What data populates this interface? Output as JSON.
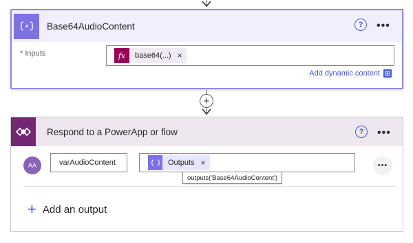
{
  "card_compose": {
    "title": "Base64AudioContent",
    "help_icon": "?",
    "more_icon": "•••",
    "inputs_label": "* Inputs",
    "expression_token": {
      "icon": "fx",
      "label": "base64(...)",
      "remove": "×"
    },
    "add_dynamic_content": "Add dynamic content",
    "accent_color": "#7e70e6",
    "expression_color": "#99005a"
  },
  "connector": {
    "add_symbol": "+"
  },
  "card_respond": {
    "title": "Respond to a PowerApp or flow",
    "help_icon": "?",
    "more_icon": "•••",
    "output_row": {
      "avatar_text": "AA",
      "output_title": "varAudioContent",
      "value_token": {
        "label": "Outputs",
        "remove": "×"
      },
      "row_more_icon": "•••",
      "tooltip": "outputs('Base64AudioContent')"
    },
    "add_output_symbol": "+",
    "add_output_label": "Add an output",
    "brand_color": "#742774"
  }
}
